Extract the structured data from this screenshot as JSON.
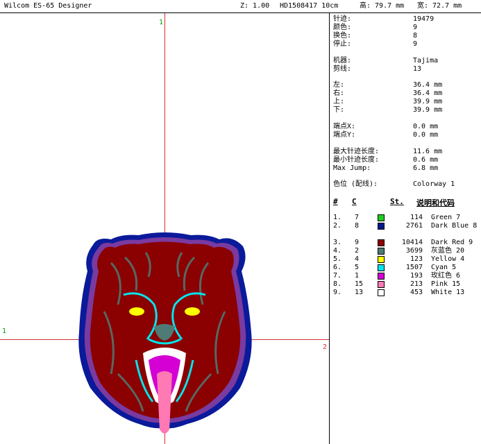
{
  "titlebar": {
    "app": "Wilcom ES-65 Designer",
    "zoom": "Z: 1.00",
    "design": "HD1508417 10cm",
    "height": "高: 79.7 mm",
    "width": "宽: 72.7 mm"
  },
  "canvas": {
    "guide_top_label": "1",
    "guide_left_label": "1",
    "guide_right_label": "2"
  },
  "info": {
    "stitches_label": "针迹:",
    "stitches": "19479",
    "colors_label": "颜色:",
    "colors": "9",
    "changes_label": "换色:",
    "changes": "8",
    "stops_label": "停止:",
    "stops": "9",
    "machine_label": "机器:",
    "machine": "Tajima",
    "trims_label": "剪线:",
    "trims": "13",
    "left_label": "左:",
    "left": "36.4 mm",
    "right_label": "右:",
    "right": "36.4 mm",
    "up_label": "上:",
    "up": "39.9 mm",
    "down_label": "下:",
    "down": "39.9 mm",
    "endx_label": "端点X:",
    "endx": "0.0 mm",
    "endy_label": "端点Y:",
    "endy": "0.0 mm",
    "maxlen_label": "最大针迹长度:",
    "maxlen": "11.6 mm",
    "minlen_label": "最小针迹长度:",
    "minlen": "0.6 mm",
    "maxjump_label": "Max Jump:",
    "maxjump": "6.8 mm",
    "colorway_label": "色位 (配线):",
    "colorway": "Colorway 1"
  },
  "color_table": {
    "headers": {
      "num": "#",
      "code": "C",
      "stitches": "St.",
      "desc": "说明和代码"
    },
    "rows": [
      {
        "num": "1.",
        "code": "7",
        "color": "#22cc22",
        "stitches": "114",
        "desc": "Green 7"
      },
      {
        "num": "2.",
        "code": "8",
        "color": "#001a8c",
        "stitches": "2761",
        "desc": "Dark Blue 8"
      },
      {
        "num": "3.",
        "code": "9",
        "color": "#8b0000",
        "stitches": "10414",
        "desc": "Dark Red 9"
      },
      {
        "num": "4.",
        "code": "2",
        "color": "#4f7b76",
        "stitches": "3699",
        "desc": "灰蓝色 20"
      },
      {
        "num": "5.",
        "code": "4",
        "color": "#ffff00",
        "stitches": "123",
        "desc": "Yellow 4"
      },
      {
        "num": "6.",
        "code": "5",
        "color": "#00e5ee",
        "stitches": "1507",
        "desc": "Cyan 5"
      },
      {
        "num": "7.",
        "code": "1",
        "color": "#d400d4",
        "stitches": "193",
        "desc": "玫红色 6"
      },
      {
        "num": "8.",
        "code": "15",
        "color": "#ff79b4",
        "stitches": "213",
        "desc": "Pink 15"
      },
      {
        "num": "9.",
        "code": "13",
        "color": "#ffffff",
        "stitches": "453",
        "desc": "White 13"
      }
    ]
  }
}
